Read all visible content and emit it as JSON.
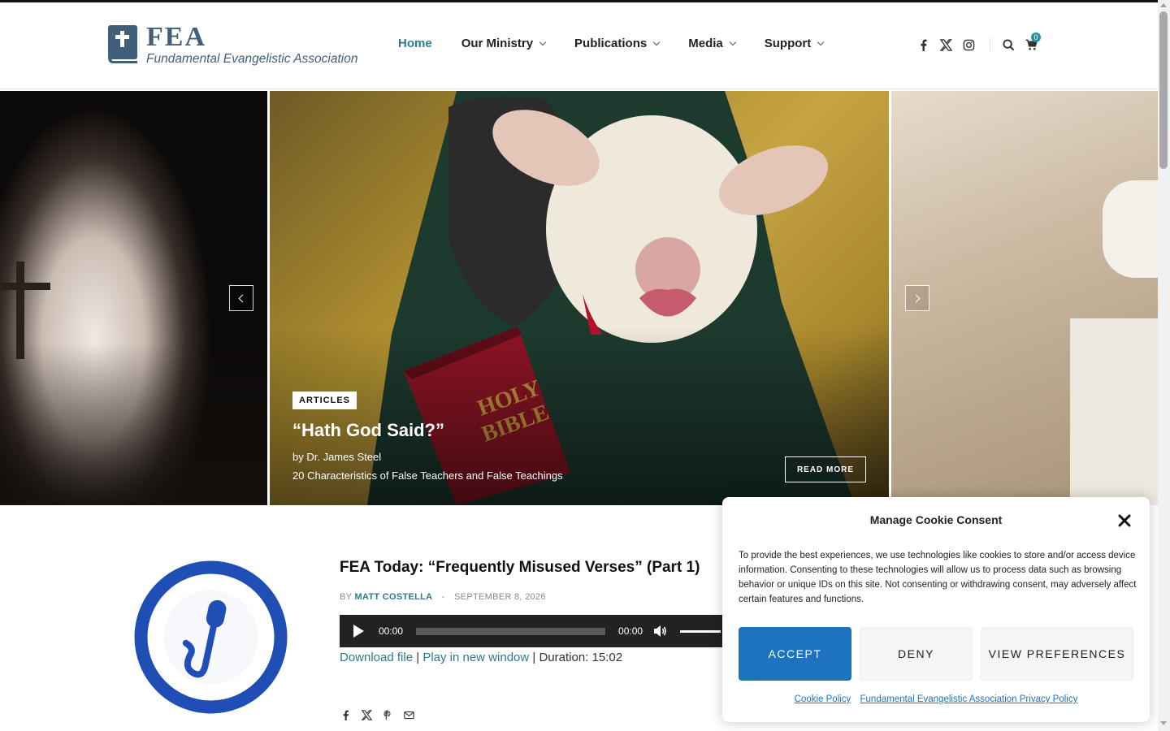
{
  "header": {
    "logo_title": "FEA",
    "logo_subtitle": "Fundamental Evangelistic Association",
    "nav": [
      {
        "label": "Home",
        "active": true
      },
      {
        "label": "Our Ministry"
      },
      {
        "label": "Publications"
      },
      {
        "label": "Media"
      },
      {
        "label": "Support"
      }
    ],
    "social_icons": [
      "facebook-icon",
      "x-icon",
      "instagram-icon"
    ],
    "cart_count": "0"
  },
  "slider": {
    "category": "ARTICLES",
    "title": "“Hath God Said?”",
    "author": "by Dr. James Steel",
    "excerpt": "20 Characteristics of False Teachers and False Teachings",
    "read_more": "READ MORE"
  },
  "post": {
    "title": "FEA Today: “Frequently Misused Verses” (Part 1)",
    "by_label": "BY",
    "author": "MATT COSTELLA",
    "meta_separator": "-",
    "date": "SEPTEMBER 8, 2026",
    "player": {
      "current_time": "00:00",
      "duration_time": "00:00",
      "progress": 0
    },
    "download_label": "Download file",
    "separator": "|",
    "play_window_label": "Play in new window",
    "duration_label": "Duration: 15:02"
  },
  "cookie": {
    "title": "Manage Cookie Consent",
    "text": "To provide the best experiences, we use technologies like cookies to store and/or access device information. Consenting to these technologies will allow us to process data such as browsing behavior or unique IDs on this site. Not consenting or withdrawing consent, may adversely affect certain features and functions.",
    "accept": "ACCEPT",
    "deny": "DENY",
    "preferences": "VIEW PREFERENCES",
    "cookie_policy": "Cookie Policy",
    "privacy_policy": "Fundamental Evangelistic Association Privacy Policy"
  },
  "colors": {
    "accent": "#2c7a8f",
    "brand": "#3f5f7a",
    "accept_button": "#1e73be"
  }
}
